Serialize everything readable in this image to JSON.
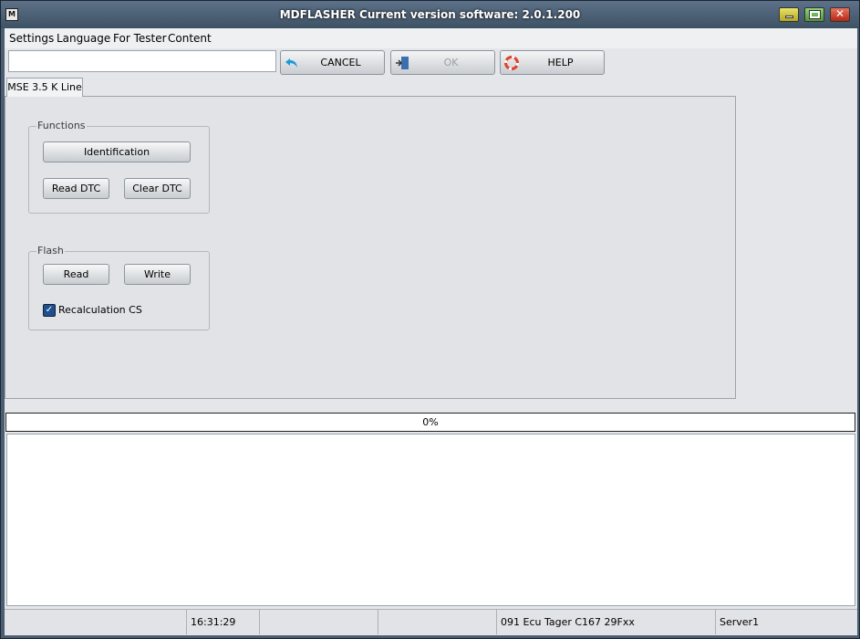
{
  "window": {
    "title": "MDFLASHER  Current version software: 2.0.1.200",
    "icon": "app-logo-icon"
  },
  "menu": [
    "Settings",
    "Language",
    "For Tester",
    "Content"
  ],
  "toolbar": {
    "path_value": "",
    "cancel_label": "CANCEL",
    "ok_label": "OK",
    "help_label": "HELP"
  },
  "tab": {
    "label": "MSE 3.5  K Line"
  },
  "functions": {
    "legend": "Functions",
    "identification_label": "Identification",
    "read_dtc_label": "Read DTC",
    "clear_dtc_label": "Clear DTC"
  },
  "flash": {
    "legend": "Flash",
    "read_label": "Read",
    "write_label": "Write",
    "recalc_label": "Recalculation CS",
    "recalc_checked": true
  },
  "progress": {
    "text": "0%",
    "value": 0
  },
  "status": {
    "time": "16:31:29",
    "ecu": "091 Ecu Tager C167 29Fxx",
    "server": "Server1"
  },
  "colors": {
    "accent": "#1f4f8f",
    "titlebar": "#4a5d72"
  }
}
